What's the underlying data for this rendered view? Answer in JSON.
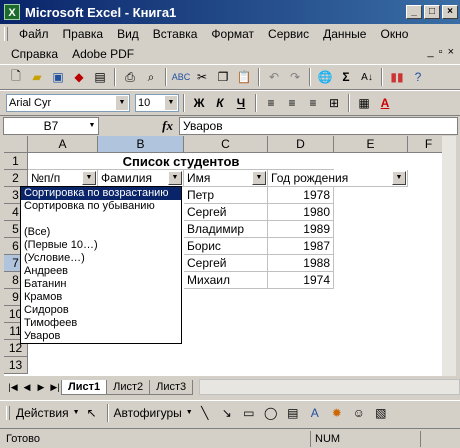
{
  "window": {
    "title": "Microsoft Excel - Книга1"
  },
  "menu": {
    "items": [
      "Файл",
      "Правка",
      "Вид",
      "Вставка",
      "Формат",
      "Сервис",
      "Данные",
      "Окно"
    ],
    "items2": [
      "Справка",
      "Adobe PDF"
    ]
  },
  "format_toolbar": {
    "font": "Arial Cyr",
    "size": "10",
    "bold": "Ж",
    "italic": "К",
    "underline": "Ч"
  },
  "formula_bar": {
    "cell": "B7",
    "fx": "fx",
    "value": "Уваров"
  },
  "columns": [
    "A",
    "B",
    "C",
    "D",
    "E",
    "F"
  ],
  "rows": [
    "1",
    "2",
    "3",
    "4",
    "5",
    "6",
    "7",
    "8",
    "9",
    "10",
    "11",
    "12",
    "13"
  ],
  "sheet": {
    "title": "Список студентов",
    "headers": [
      "№п/п",
      "Фамилия",
      "Имя",
      "Год рождения"
    ],
    "names": [
      "Петр",
      "Сергей",
      "Владимир",
      "Борис",
      "Сергей",
      "Михаил"
    ],
    "years": [
      "1978",
      "1980",
      "1989",
      "1987",
      "1988",
      "1974"
    ]
  },
  "autofilter": {
    "options": [
      "Сортировка по возрастанию",
      "Сортировка по убыванию",
      "",
      "(Все)",
      "(Первые 10…)",
      "(Условие…)",
      "Андреев",
      "Батанин",
      "Крамов",
      "Сидоров",
      "Тимофеев",
      "Уваров"
    ]
  },
  "tabs": [
    "Лист1",
    "Лист2",
    "Лист3"
  ],
  "drawing": {
    "actions": "Действия",
    "autoshapes": "Автофигуры"
  },
  "status": {
    "ready": "Готово",
    "num": "NUM"
  }
}
